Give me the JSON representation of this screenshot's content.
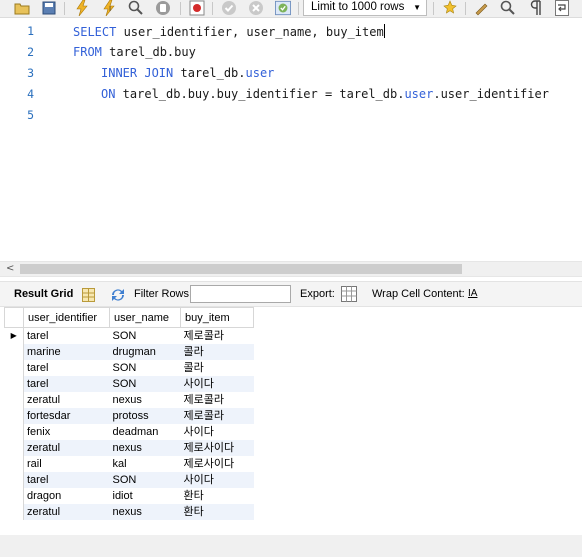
{
  "toolbar": {
    "icons": [
      "open-folder-icon",
      "save-icon",
      "execute-icon",
      "execute-current-icon",
      "explain-icon",
      "stop-icon",
      "toggle-continue-icon",
      "commit-icon",
      "rollback-icon",
      "autocommit-icon",
      "beautify-icon",
      "find-icon",
      "invisible-chars-icon",
      "wrap-icon"
    ],
    "limit_label": "Limit to 1000 rows"
  },
  "editor": {
    "lines": [
      "1",
      "2",
      "3",
      "4",
      "5"
    ],
    "code": {
      "l1_kw": "SELECT",
      "l1_rest": " user_identifier, user_name, buy_item",
      "l2_kw": "FROM",
      "l2_rest": " tarel_db.buy",
      "l3_kw": "INNER JOIN",
      "l3_rest": " tarel_db.",
      "l3_obj": "user",
      "l4_kw": "ON",
      "l4_rest": " tarel_db.buy.buy_identifier = tarel_db.",
      "l4_obj": "user",
      "l4_tail": ".user_identifier"
    }
  },
  "result_bar": {
    "result_grid": "Result Grid",
    "filter_rows": "Filter Rows:",
    "export": "Export:",
    "wrap_cell": "Wrap Cell Content:",
    "wrap_icon": "IA"
  },
  "grid": {
    "columns": [
      "user_identifier",
      "user_name",
      "buy_item"
    ],
    "rows": [
      [
        "tarel",
        "SON",
        "제로콜라"
      ],
      [
        "marine",
        "drugman",
        "콜라"
      ],
      [
        "tarel",
        "SON",
        "콜라"
      ],
      [
        "tarel",
        "SON",
        "사이다"
      ],
      [
        "zeratul",
        "nexus",
        "제로콜라"
      ],
      [
        "fortesdar",
        "protoss",
        "제로콜라"
      ],
      [
        "fenix",
        "deadman",
        "사이다"
      ],
      [
        "zeratul",
        "nexus",
        "제로사이다"
      ],
      [
        "rail",
        "kal",
        "제로사이다"
      ],
      [
        "tarel",
        "SON",
        "사이다"
      ],
      [
        "dragon",
        "idiot",
        "환타"
      ],
      [
        "zeratul",
        "nexus",
        "환타"
      ]
    ]
  }
}
